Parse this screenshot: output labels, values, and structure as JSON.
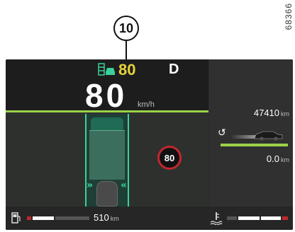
{
  "callout": {
    "number": "10"
  },
  "reference_code": "68366",
  "cluster": {
    "acc_set_speed": "80",
    "gear": "D",
    "speed": "80",
    "speed_unit": "km/h",
    "speed_limit_sign": "80",
    "odometer": {
      "value": "47410",
      "unit": "km"
    },
    "trip": {
      "value": "0.0",
      "unit": "km"
    },
    "range": {
      "value": "510",
      "unit": "km"
    },
    "colors": {
      "accent_green": "#9bd24a",
      "lane_green": "#3bd19a",
      "acc_yellow": "#e9d23a",
      "limit_red": "#c1272d"
    }
  },
  "icons": {
    "acc": "adaptive-cruise-icon",
    "reset": "reset-icon",
    "fuel": "fuel-pump-icon",
    "temperature": "coolant-temperature-icon"
  }
}
